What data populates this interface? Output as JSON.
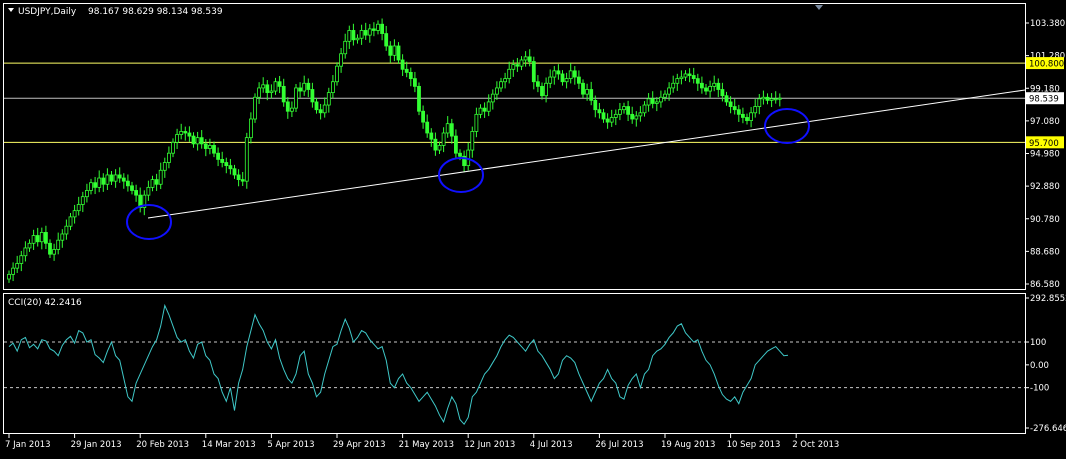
{
  "colors": {
    "background": "#000000",
    "bull_candle": "#33ff33",
    "bear_candle": "#33ff33",
    "frame": "#ffffff",
    "hline": "#ffff66",
    "bid_line": "#bfbfbf",
    "trendline": "#ffffff",
    "ellipse": "#1010ff",
    "cci_line": "#3fc8c8",
    "cci_levels": "#c8c8c8",
    "level_tag_bg": "#ffff00",
    "price_tag_bg": "#ffffff"
  },
  "header": {
    "symbol_label": "USDJPY,Daily",
    "ohlc_label": "98.167 98.629 98.134 98.539"
  },
  "cci_header": {
    "label": "CCI(20) 42.2416"
  },
  "price_axis": {
    "ticks": [
      "103.380",
      "101.280",
      "99.180",
      "97.080",
      "94.980",
      "92.880",
      "90.780",
      "88.680",
      "86.580"
    ],
    "tick_values": [
      103.38,
      101.28,
      99.18,
      97.08,
      94.98,
      92.88,
      90.78,
      88.68,
      86.58
    ],
    "level_tags": [
      "100.800",
      "95.700"
    ],
    "current_price_tag": "98.539"
  },
  "cci_axis": {
    "ticks": [
      "292.8552",
      "100",
      "0.00",
      "-100",
      "-276.646"
    ],
    "tick_values": [
      292.8552,
      100,
      0,
      -100,
      -276.646
    ]
  },
  "time_axis": {
    "labels": [
      "7 Jan 2013",
      "29 Jan 2013",
      "20 Feb 2013",
      "14 Mar 2013",
      "5 Apr 2013",
      "29 Apr 2013",
      "21 May 2013",
      "12 Jun 2013",
      "4 Jul 2013",
      "26 Jul 2013",
      "19 Aug 2013",
      "10 Sep 2013",
      "2 Oct 2013"
    ],
    "label_bar_index": [
      0,
      16,
      32,
      48,
      64,
      80,
      96,
      112,
      128,
      144,
      160,
      176,
      192
    ]
  },
  "chart_data": [
    {
      "type": "candlestick",
      "title": "USDJPY,Daily",
      "ohlc_last": {
        "open": 98.167,
        "high": 98.629,
        "low": 98.134,
        "close": 98.539
      },
      "ylim": [
        86.4,
        104.2
      ],
      "horizontal_levels": [
        100.8,
        95.7
      ],
      "current_price": 98.539,
      "closes": [
        87.2,
        87.6,
        87.9,
        88.4,
        88.9,
        89.2,
        89.7,
        89.3,
        89.9,
        89.2,
        88.5,
        88.8,
        89.4,
        89.8,
        90.3,
        90.9,
        91.3,
        91.7,
        92.2,
        92.6,
        93.1,
        92.8,
        93.4,
        93.0,
        93.6,
        93.2,
        93.6,
        93.4,
        93.2,
        92.9,
        92.6,
        92.3,
        91.5,
        92.3,
        92.8,
        93.3,
        93.0,
        93.9,
        94.4,
        95.0,
        95.7,
        96.2,
        96.4,
        96.3,
        96.1,
        95.6,
        96.0,
        95.6,
        95.3,
        95.5,
        95.0,
        94.6,
        94.4,
        94.2,
        94.0,
        93.6,
        93.3,
        93.2,
        96.0,
        97.2,
        98.6,
        99.2,
        99.4,
        98.9,
        99.0,
        99.6,
        99.3,
        98.3,
        97.7,
        97.9,
        99.2,
        99.0,
        99.5,
        99.1,
        98.3,
        97.8,
        97.6,
        98.1,
        98.9,
        99.6,
        100.6,
        101.4,
        102.2,
        102.9,
        102.3,
        102.4,
        102.9,
        102.6,
        103.0,
        102.9,
        103.3,
        102.7,
        101.9,
        101.3,
        101.9,
        101.0,
        100.4,
        100.2,
        99.8,
        99.3,
        97.7,
        97.0,
        96.3,
        95.9,
        95.2,
        95.5,
        96.3,
        96.9,
        96.1,
        95.0,
        94.8,
        94.2,
        95.2,
        96.4,
        97.5,
        97.9,
        97.7,
        98.3,
        98.8,
        99.2,
        99.6,
        99.8,
        100.4,
        100.7,
        100.6,
        101.0,
        101.2,
        100.9,
        99.6,
        99.3,
        98.7,
        99.5,
        99.9,
        100.3,
        100.1,
        99.6,
        99.8,
        100.3,
        99.9,
        99.5,
        98.8,
        99.1,
        98.4,
        97.8,
        97.6,
        97.2,
        97.0,
        97.3,
        97.5,
        97.8,
        98.0,
        97.5,
        97.2,
        97.4,
        97.6,
        98.1,
        98.5,
        98.2,
        98.3,
        98.6,
        98.8,
        99.2,
        99.5,
        99.8,
        99.9,
        100.1,
        100.0,
        99.8,
        99.5,
        99.2,
        99.0,
        99.3,
        99.5,
        99.1,
        98.7,
        98.3,
        98.0,
        97.8,
        97.5,
        97.3,
        97.1,
        97.6,
        98.0,
        98.5,
        98.6,
        98.4,
        98.5,
        98.5,
        98.539
      ]
    },
    {
      "type": "line",
      "title": "CCI(20) 42.2416",
      "ylim": [
        -276.646,
        292.8552
      ],
      "levels": [
        100,
        -100
      ],
      "last_value": 42.2416,
      "values": [
        80,
        95,
        60,
        110,
        120,
        75,
        90,
        70,
        110,
        105,
        70,
        60,
        40,
        85,
        110,
        125,
        95,
        150,
        140,
        100,
        110,
        45,
        30,
        10,
        60,
        100,
        40,
        20,
        -60,
        -140,
        -160,
        -80,
        -40,
        0,
        40,
        80,
        110,
        170,
        260,
        220,
        170,
        120,
        100,
        110,
        60,
        30,
        90,
        100,
        40,
        20,
        -40,
        -60,
        -120,
        -160,
        -100,
        -200,
        -80,
        -20,
        80,
        150,
        220,
        180,
        150,
        100,
        70,
        110,
        30,
        -20,
        -60,
        -80,
        -40,
        40,
        60,
        -40,
        -80,
        -140,
        -120,
        -40,
        20,
        80,
        90,
        150,
        200,
        160,
        100,
        120,
        150,
        140,
        110,
        90,
        70,
        80,
        20,
        -80,
        -100,
        -60,
        -40,
        -80,
        -100,
        -130,
        -160,
        -140,
        -120,
        -150,
        -180,
        -220,
        -250,
        -190,
        -140,
        -170,
        -240,
        -260,
        -230,
        -140,
        -120,
        -80,
        -40,
        -20,
        10,
        40,
        80,
        110,
        130,
        120,
        100,
        80,
        60,
        90,
        110,
        60,
        40,
        10,
        -20,
        -60,
        -40,
        20,
        40,
        30,
        10,
        -40,
        -80,
        -120,
        -160,
        -120,
        -80,
        -60,
        -20,
        -60,
        -80,
        -140,
        -150,
        -90,
        -60,
        -40,
        -100,
        -40,
        -20,
        40,
        60,
        70,
        90,
        120,
        140,
        170,
        180,
        140,
        120,
        100,
        110,
        60,
        20,
        0,
        -40,
        -90,
        -130,
        -150,
        -160,
        -140,
        -170,
        -120,
        -90,
        -60,
        0,
        20,
        40,
        60,
        70,
        80,
        60,
        40,
        42.2416
      ]
    }
  ]
}
